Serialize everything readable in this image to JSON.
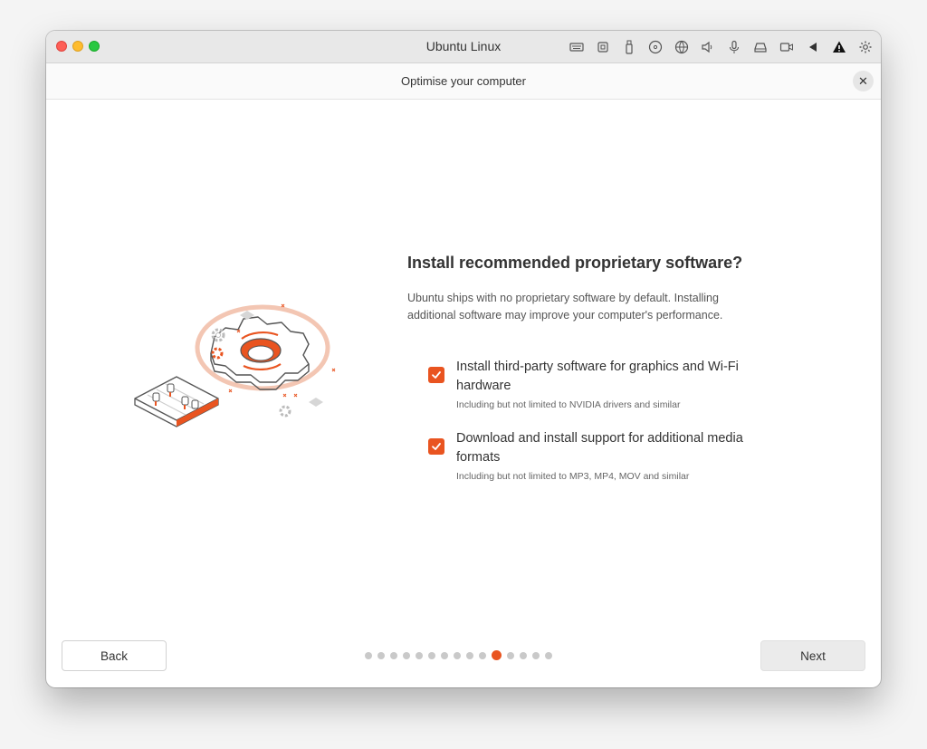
{
  "vm": {
    "title": "Ubuntu Linux",
    "toolbar_icons": [
      "keyboard-icon",
      "cpu-icon",
      "usb-icon",
      "cd-icon",
      "network-icon",
      "speaker-icon",
      "microphone-icon",
      "disk-icon",
      "camera-icon",
      "share-icon",
      "warning-icon",
      "settings-icon"
    ]
  },
  "window": {
    "title": "Optimise your computer",
    "close_symbol": "✕"
  },
  "main": {
    "heading": "Install recommended proprietary software?",
    "description": "Ubuntu ships with no proprietary software by default. Installing additional software may improve your computer's performance.",
    "options": [
      {
        "label": "Install third-party software for graphics and Wi-Fi hardware",
        "sub": "Including but not limited to NVIDIA drivers and similar",
        "checked": true
      },
      {
        "label": "Download and install support for additional media formats",
        "sub": "Including but not limited to MP3, MP4, MOV and similar",
        "checked": true
      }
    ]
  },
  "footer": {
    "back_label": "Back",
    "next_label": "Next",
    "step_total": 15,
    "step_current": 11
  },
  "colors": {
    "accent": "#e95420",
    "dot_inactive": "#c9c9c9"
  }
}
